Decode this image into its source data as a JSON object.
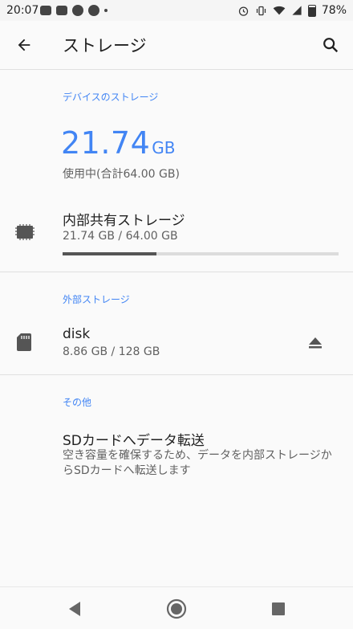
{
  "status_bar": {
    "time": "20:07",
    "battery": "78%"
  },
  "app_bar": {
    "title": "ストレージ",
    "back_icon": "arrow-back-icon",
    "search_icon": "search-icon"
  },
  "device_storage": {
    "header": "デバイスのストレージ",
    "used_value": "21.74",
    "used_unit": "GB",
    "summary": "使用中(合計64.00 GB)"
  },
  "internal_storage": {
    "title": "内部共有ストレージ",
    "detail": "21.74 GB / 64.00 GB",
    "progress": 0.34
  },
  "external_storage": {
    "header": "外部ストレージ",
    "name": "disk",
    "detail": "8.86 GB / 128 GB"
  },
  "other": {
    "header": "その他",
    "title": "SDカードへデータ転送",
    "description": "空き容量を確保するため、データを内部ストレージからSDカードへ転送します"
  },
  "colors": {
    "accent": "#4285f4",
    "progress_fill": "#555555",
    "progress_track": "#dcdcdc"
  }
}
